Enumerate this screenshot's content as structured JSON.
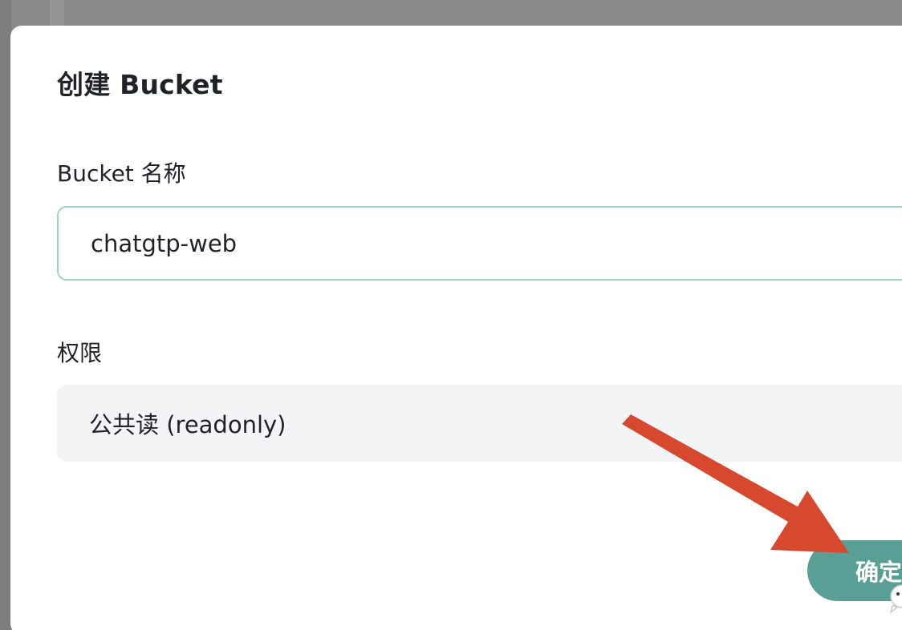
{
  "dialog": {
    "title": "创建 Bucket",
    "name_label": "Bucket 名称",
    "name_value": "chatgtp-web",
    "permission_label": "权限",
    "permission_value": "公共读 (readonly)",
    "confirm_label": "确定"
  },
  "colors": {
    "primary": "#5a9f96",
    "input_border": "#9ed3cd",
    "select_bg": "#f3f4f6",
    "annotation_arrow": "#d6492f",
    "backdrop": "#8a8a8a"
  },
  "icons": {
    "annotation": "arrow-annotation-icon",
    "chat": "chat-bubble-icon"
  }
}
